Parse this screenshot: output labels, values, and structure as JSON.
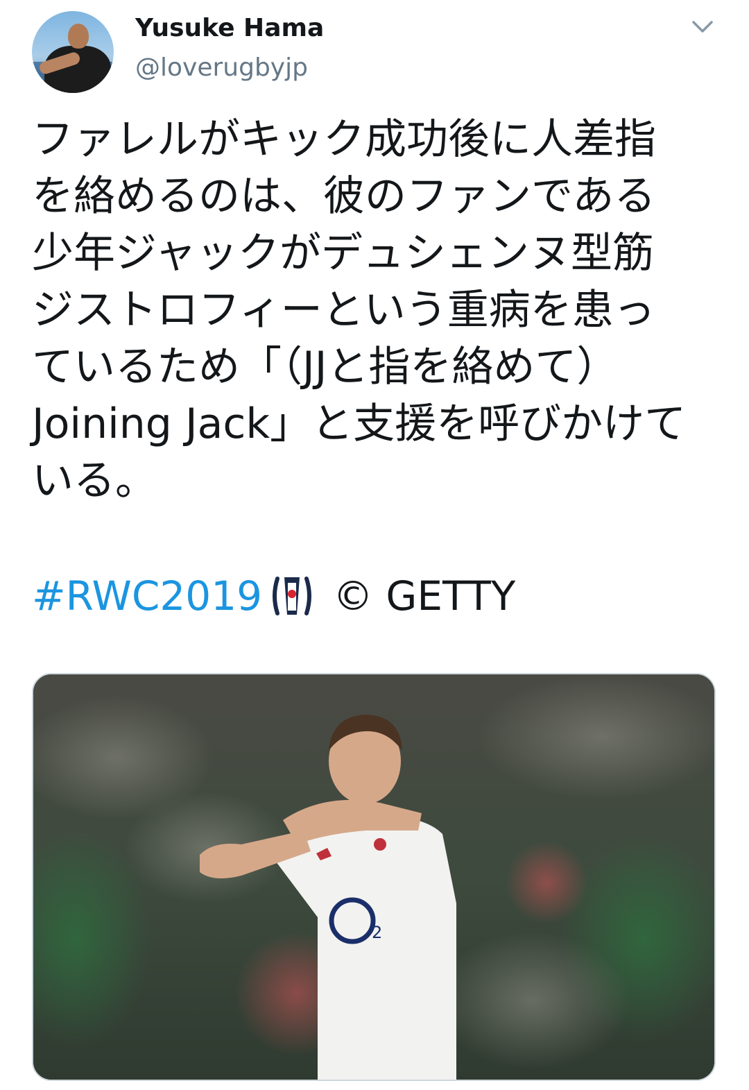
{
  "author": {
    "name": "Yusuke Hama",
    "handle": "@loverugbyjp"
  },
  "tweet": {
    "lines": [
      "ファレルがキック成功後に人差指",
      "を絡めるのは、彼のファンである",
      "少年ジャックがデュシェンヌ型筋",
      "ジストロフィーという重病を患っ",
      "ているため「（JJと指を絡めて）",
      "Joining Jack」と支援を呼びかけて",
      "いる。"
    ],
    "hashtag": "#RWC2019",
    "credit": "© GETTY"
  },
  "icons": {
    "caret": "chevron-down-icon",
    "hashtag_emoji": "rugby-world-cup-logo-icon"
  },
  "colors": {
    "link": "#1b95e0",
    "text": "#14171a",
    "secondary": "#657786"
  }
}
